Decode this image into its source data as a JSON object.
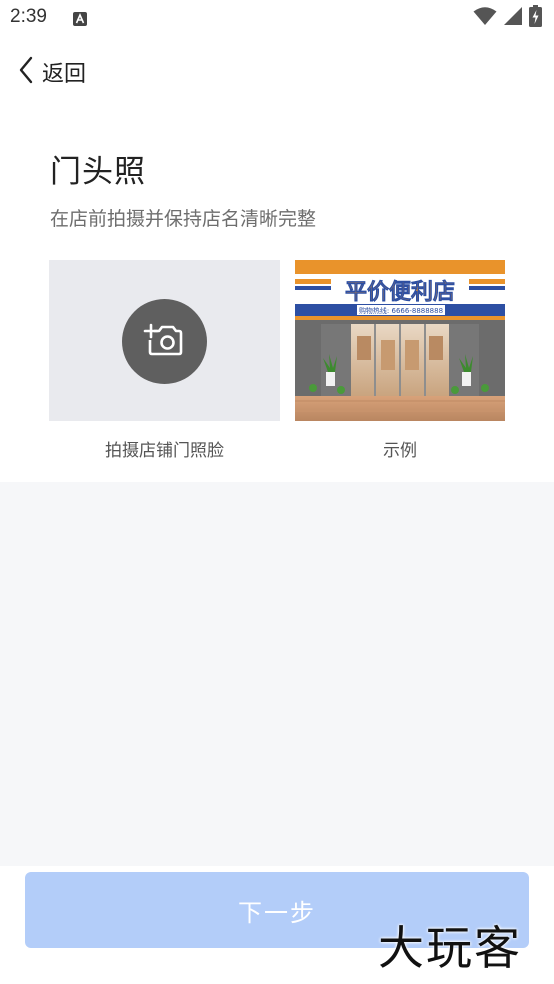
{
  "status_bar": {
    "time": "2:39",
    "notification_icon": "text-a-icon",
    "icons": [
      "wifi-icon",
      "signal-icon",
      "battery-charging-icon"
    ]
  },
  "nav": {
    "back_label": "返回",
    "back_icon": "chevron-left-icon"
  },
  "section": {
    "title": "门头照",
    "subtitle": "在店前拍摄并保持店名清晰完整"
  },
  "upload": {
    "icon": "add-photo-camera-icon",
    "caption": "拍摄店铺门照脸"
  },
  "example": {
    "caption": "示例",
    "photo": {
      "sign_main": "平价便利店",
      "sign_hotline": "购物热线: 6666-8888888"
    }
  },
  "footer": {
    "next_label": "下一步"
  },
  "watermark": "大玩客",
  "colors": {
    "accent_disabled": "#b3cdf9",
    "page_background": "#f6f7f9",
    "upload_background": "#e9eaee",
    "camera_circle": "#5f5f5f"
  }
}
